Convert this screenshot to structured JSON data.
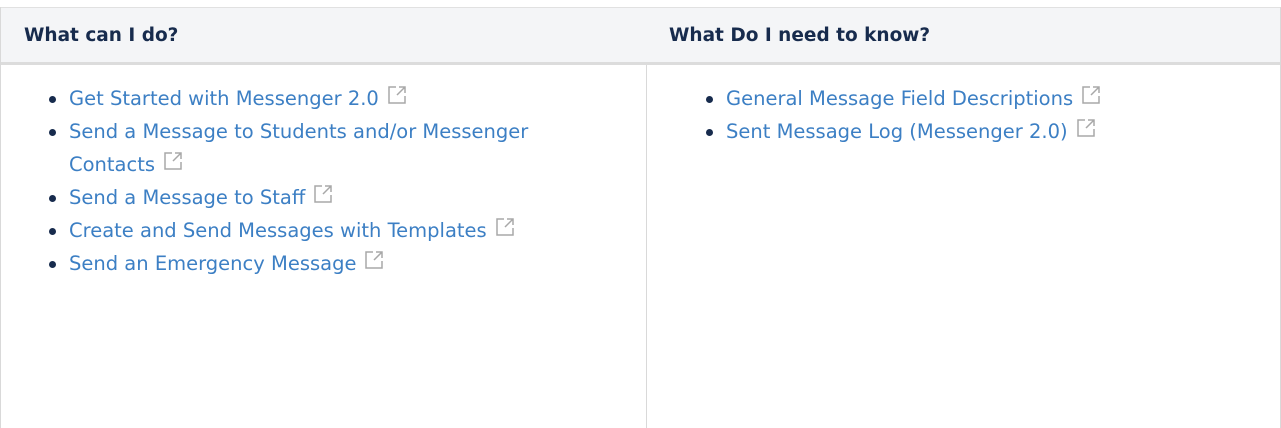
{
  "left": {
    "header": "What can I do?",
    "links": [
      "Get Started with Messenger 2.0",
      "Send a Message to Students and/or Messenger Contacts",
      "Send a Message to Staff",
      "Create and Send Messages with Templates",
      "Send an Emergency Message"
    ]
  },
  "right": {
    "header": "What Do I need to know?",
    "links": [
      "General Message Field Descriptions",
      "Sent Message Log (Messenger 2.0)"
    ]
  },
  "colors": {
    "link": "#3c7fc4",
    "header_text": "#172b4d",
    "header_bg": "#f4f5f7"
  },
  "icons": {
    "external": "external-link-icon"
  }
}
